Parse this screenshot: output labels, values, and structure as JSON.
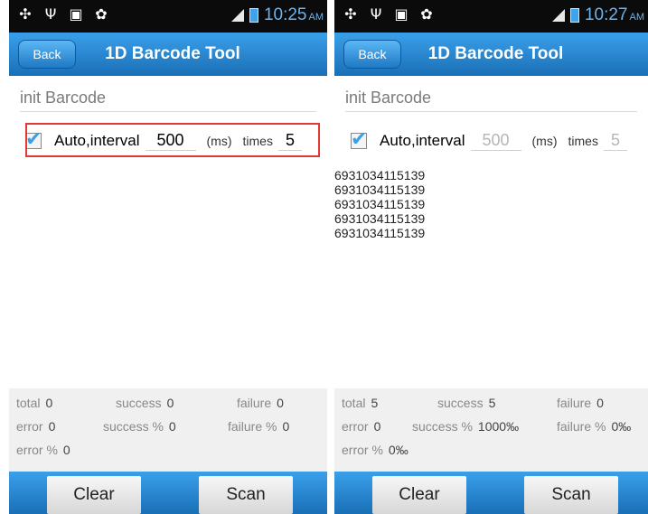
{
  "screens": [
    {
      "status_time": "10:25",
      "status_ampm": "AM",
      "back_label": "Back",
      "title": "1D Barcode Tool",
      "init_placeholder": "init Barcode",
      "auto_label": "Auto,interval",
      "interval_value": "500",
      "unit": "(ms)",
      "times_label": "times",
      "times_value": "5",
      "results": [],
      "stats": {
        "total_label": "total",
        "total": "0",
        "success_label": "success",
        "success": "0",
        "failure_label": "failure",
        "failure": "0",
        "error_label": "error",
        "error": "0",
        "success_pct_label": "success %",
        "success_pct": "0",
        "failure_pct_label": "failure %",
        "failure_pct": "0",
        "error_pct_label": "error %",
        "error_pct": "0"
      },
      "clear_label": "Clear",
      "scan_label": "Scan"
    },
    {
      "status_time": "10:27",
      "status_ampm": "AM",
      "back_label": "Back",
      "title": "1D Barcode Tool",
      "init_placeholder": "init Barcode",
      "auto_label": "Auto,interval",
      "interval_value": "500",
      "unit": "(ms)",
      "times_label": "times",
      "times_value": "5",
      "results": [
        "6931034115139",
        "6931034115139",
        "6931034115139",
        "6931034115139",
        "6931034115139"
      ],
      "stats": {
        "total_label": "total",
        "total": "5",
        "success_label": "success",
        "success": "5",
        "failure_label": "failure",
        "failure": "0",
        "error_label": "error",
        "error": "0",
        "success_pct_label": "success %",
        "success_pct": "1000‰",
        "failure_pct_label": "failure %",
        "failure_pct": "0‰",
        "error_pct_label": "error %",
        "error_pct": "0‰"
      },
      "clear_label": "Clear",
      "scan_label": "Scan"
    }
  ]
}
